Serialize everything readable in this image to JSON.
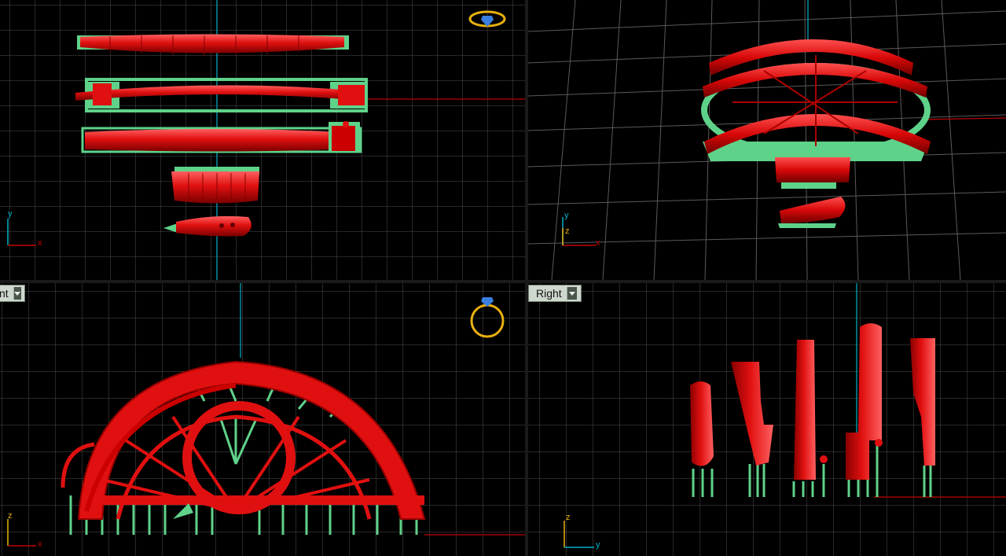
{
  "viewports": {
    "top": {
      "label": "",
      "axes": {
        "a": "y",
        "b": "x"
      }
    },
    "perspective": {
      "label": "",
      "axes": {
        "a": "y",
        "b": "z",
        "c": "x"
      }
    },
    "front": {
      "label": "nt",
      "axes": {
        "a": "z",
        "b": "x"
      }
    },
    "right": {
      "label": "Right",
      "axes": {
        "a": "z",
        "b": "y"
      }
    }
  },
  "icons": {
    "ring_top": "ring-gumball-icon",
    "ring_front": "ring-gumball-icon"
  },
  "colors": {
    "grid": "#5a5a5a",
    "grid_major": "#8a8a8a",
    "model": "#e01010",
    "support": "#5fd28a",
    "axis_x": "#c00000",
    "axis_y": "#00b0c8",
    "gizmo": "#e8b010"
  }
}
